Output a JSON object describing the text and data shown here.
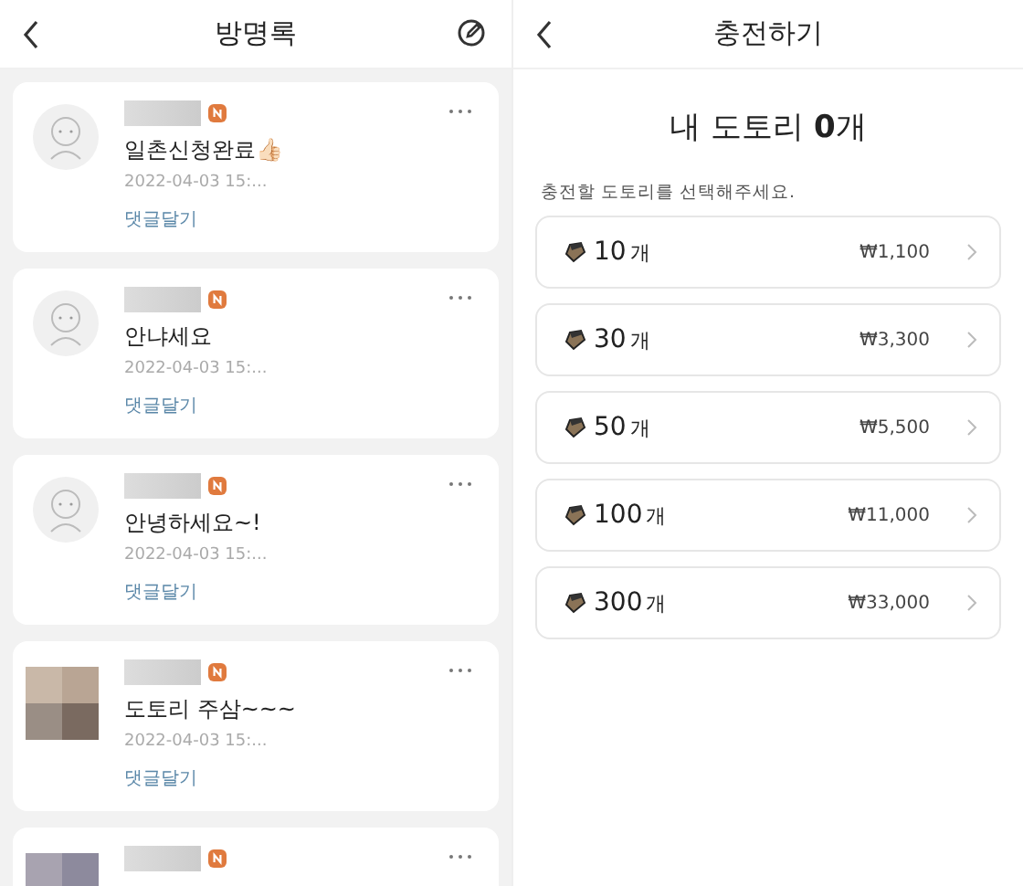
{
  "guestbook": {
    "title": "방명록",
    "entries": [
      {
        "kind": "default",
        "message": "일촌신청완료👍🏻",
        "time": "2022-04-03 15:...",
        "reply": "댓글달기"
      },
      {
        "kind": "default",
        "message": "안냐세요",
        "time": "2022-04-03 15:...",
        "reply": "댓글달기"
      },
      {
        "kind": "default",
        "message": "안녕하세요~!",
        "time": "2022-04-03 15:...",
        "reply": "댓글달기"
      },
      {
        "kind": "photo",
        "message": "도토리 주삼~~~",
        "time": "2022-04-03 15:...",
        "reply": "댓글달기"
      },
      {
        "kind": "photo"
      }
    ]
  },
  "charge": {
    "title": "충전하기",
    "balance": "내 도토리 **0**개",
    "prompt": "충전할 도토리를 선택해주세요.",
    "options": [
      {
        "amount": "10",
        "unit": "개",
        "price": "₩1,100"
      },
      {
        "amount": "30",
        "unit": "개",
        "price": "₩3,300"
      },
      {
        "amount": "50",
        "unit": "개",
        "price": "₩5,500"
      },
      {
        "amount": "100",
        "unit": "개",
        "price": "₩11,000"
      },
      {
        "amount": "300",
        "unit": "개",
        "price": "₩33,000"
      }
    ]
  }
}
